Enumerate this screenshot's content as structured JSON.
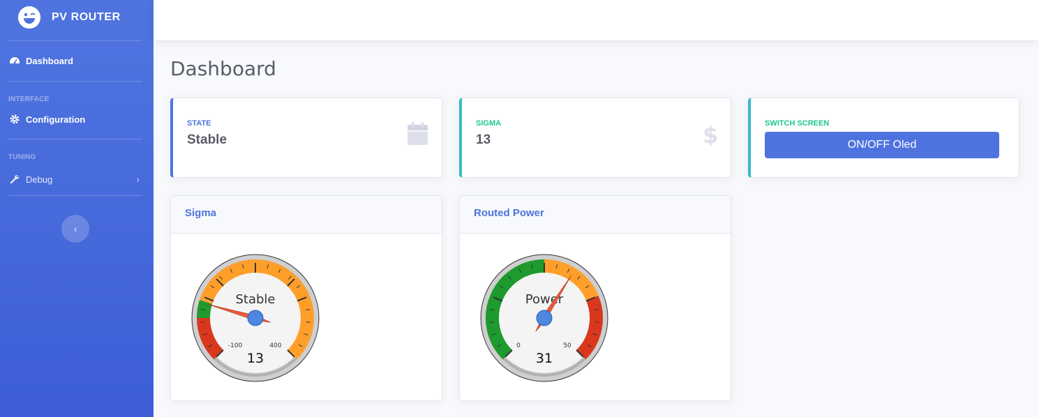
{
  "sidebar": {
    "brand": "PV ROUTER",
    "dashboard": "Dashboard",
    "heading_interface": "INTERFACE",
    "configuration": "Configuration",
    "heading_tuning": "TUNING",
    "debug": "Debug"
  },
  "page": {
    "title": "Dashboard"
  },
  "cards": {
    "state": {
      "label": "STATE",
      "value": "Stable",
      "label_color": "#4e73df",
      "icon": "calendar-icon"
    },
    "sigma": {
      "label": "SIGMA",
      "value": "13",
      "label_color": "#1cc88a",
      "icon": "dollar-icon"
    },
    "switch": {
      "label": "SWITCH SCREEN",
      "button": "ON/OFF Oled",
      "label_color": "#1cc88a"
    }
  },
  "gauges": {
    "sigma": {
      "title": "Sigma",
      "label": "Stable",
      "min_label": "-100",
      "max_label": "400",
      "value_label": "13",
      "min": -100,
      "max": 400,
      "value": 13
    },
    "power": {
      "title": "Routed Power",
      "label": "Power",
      "min_label": "0",
      "max_label": "50",
      "value_label": "31",
      "min": 0,
      "max": 50,
      "value": 31
    }
  },
  "colors": {
    "primary": "#4e73df",
    "info": "#36b9cc",
    "green": "#1e9a2e",
    "orange": "#ff9f2a",
    "red": "#d9381e"
  }
}
